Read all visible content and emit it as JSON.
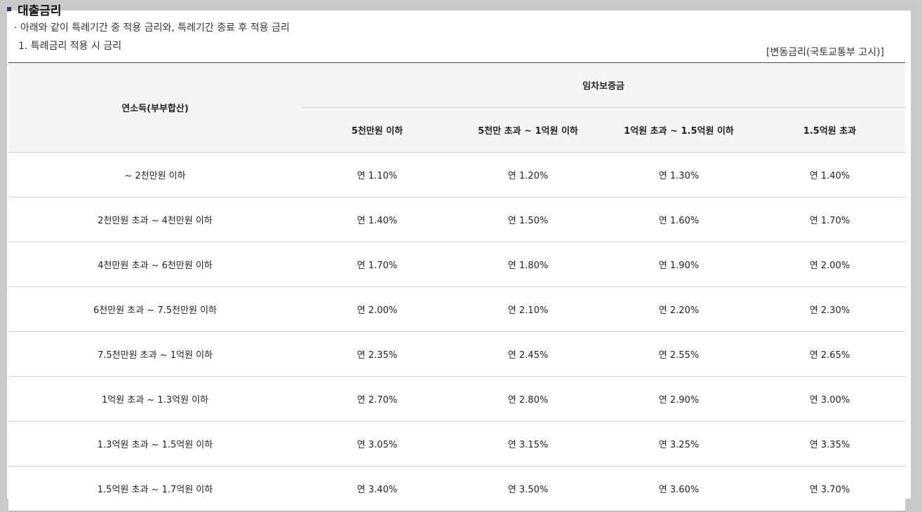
{
  "section": {
    "title": "대출금리",
    "description": "· 아래와 같이 특례기간 중 적용 금리와, 특례기간 종료 후 적용 금리",
    "subtitle": "1. 특례금리 적용 시 금리",
    "note": "[변동금리(국토교통부 고시)]"
  },
  "table": {
    "income_header": "연소득(부부합산)",
    "deposit_header": "임차보증금",
    "deposit_bands": [
      "5천만원 이하",
      "5천만 초과 ~ 1억원 이하",
      "1억원 초과 ~ 1.5억원 이하",
      "1.5억원 초과"
    ],
    "rows": [
      {
        "income": "~ 2천만원 이하",
        "rates": [
          "연 1.10%",
          "연 1.20%",
          "연 1.30%",
          "연 1.40%"
        ]
      },
      {
        "income": "2천만원 초과 ~ 4천만원 이하",
        "rates": [
          "연 1.40%",
          "연 1.50%",
          "연 1.60%",
          "연 1.70%"
        ]
      },
      {
        "income": "4천만원 초과 ~ 6천만원 이하",
        "rates": [
          "연 1.70%",
          "연 1.80%",
          "연 1.90%",
          "연 2.00%"
        ]
      },
      {
        "income": "6천만원 초과 ~ 7.5천만원 이하",
        "rates": [
          "연 2.00%",
          "연 2.10%",
          "연 2.20%",
          "연 2.30%"
        ]
      },
      {
        "income": "7.5천만원 초과 ~ 1억원 이하",
        "rates": [
          "연 2.35%",
          "연 2.45%",
          "연 2.55%",
          "연 2.65%"
        ]
      },
      {
        "income": "1억원 초과 ~ 1.3억원 이하",
        "rates": [
          "연 2.70%",
          "연 2.80%",
          "연 2.90%",
          "연 3.00%"
        ]
      },
      {
        "income": "1.3억원 초과 ~ 1.5억원 이하",
        "rates": [
          "연 3.05%",
          "연 3.15%",
          "연 3.25%",
          "연 3.35%"
        ]
      },
      {
        "income": "1.5억원 초과 ~ 1.7억원 이하",
        "rates": [
          "연 3.40%",
          "연 3.50%",
          "연 3.60%",
          "연 3.70%"
        ]
      }
    ]
  }
}
